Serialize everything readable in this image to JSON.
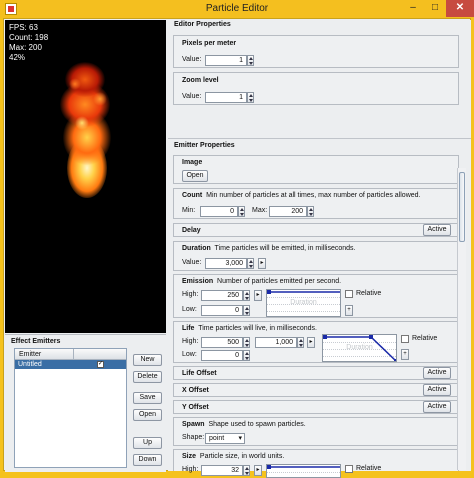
{
  "window": {
    "title": "Particle Editor",
    "minimize": "–",
    "maximize": "□",
    "close": "✕"
  },
  "stats": {
    "fps": "FPS: 63",
    "count": "Count: 198",
    "max": "Max: 200",
    "percent": "42%"
  },
  "effect_emitters": {
    "title": "Effect Emitters",
    "column_header": "Emitter",
    "rows": [
      {
        "name": "Untitled",
        "checked": "✓"
      }
    ],
    "buttons": {
      "new": "New",
      "delete": "Delete",
      "save": "Save",
      "open": "Open",
      "up": "Up",
      "down": "Down"
    }
  },
  "editor_props": {
    "title": "Editor Properties",
    "pixels_per_meter": {
      "label": "Pixels per meter",
      "value_label": "Value:",
      "value": "1"
    },
    "zoom_level": {
      "label": "Zoom level",
      "value_label": "Value:",
      "value": "1"
    }
  },
  "emitter_props": {
    "title": "Emitter Properties",
    "image": {
      "label": "Image",
      "open": "Open"
    },
    "count": {
      "label": "Count",
      "desc": "Min number of particles at all times, max number of particles allowed.",
      "min_label": "Min:",
      "min": "0",
      "max_label": "Max:",
      "max": "200"
    },
    "delay": {
      "label": "Delay",
      "active": "Active"
    },
    "duration": {
      "label": "Duration",
      "desc": "Time particles will be emitted, in milliseconds.",
      "value_label": "Value:",
      "value": "3,000",
      "expand": "▸"
    },
    "emission": {
      "label": "Emission",
      "desc": "Number of particles emitted per second.",
      "high_label": "High:",
      "high": "250",
      "low_label": "Low:",
      "low": "0",
      "relative": "Relative",
      "graph_text": "Duration",
      "expand": "▸",
      "plus": "+"
    },
    "life": {
      "label": "Life",
      "desc": "Time particles will live, in milliseconds.",
      "high_label": "High:",
      "high": "500",
      "high2": "1,000",
      "low_label": "Low:",
      "low": "0",
      "relative": "Relative",
      "graph_text": "Duration",
      "expand": "▸",
      "plus": "+"
    },
    "life_offset": {
      "label": "Life Offset",
      "active": "Active"
    },
    "x_offset": {
      "label": "X Offset",
      "active": "Active"
    },
    "y_offset": {
      "label": "Y Offset",
      "active": "Active"
    },
    "spawn": {
      "label": "Spawn",
      "desc": "Shape used to spawn particles.",
      "shape_label": "Shape:",
      "shape": "point",
      "caret": "▾"
    },
    "size": {
      "label": "Size",
      "desc": "Particle size, in world units.",
      "high_label": "High:",
      "high": "32",
      "relative": "Relative",
      "expand": "▸"
    }
  },
  "colors": {
    "titlebar": "#f4bf1f",
    "selection": "#3a6ea5",
    "close": "#c74b40"
  }
}
